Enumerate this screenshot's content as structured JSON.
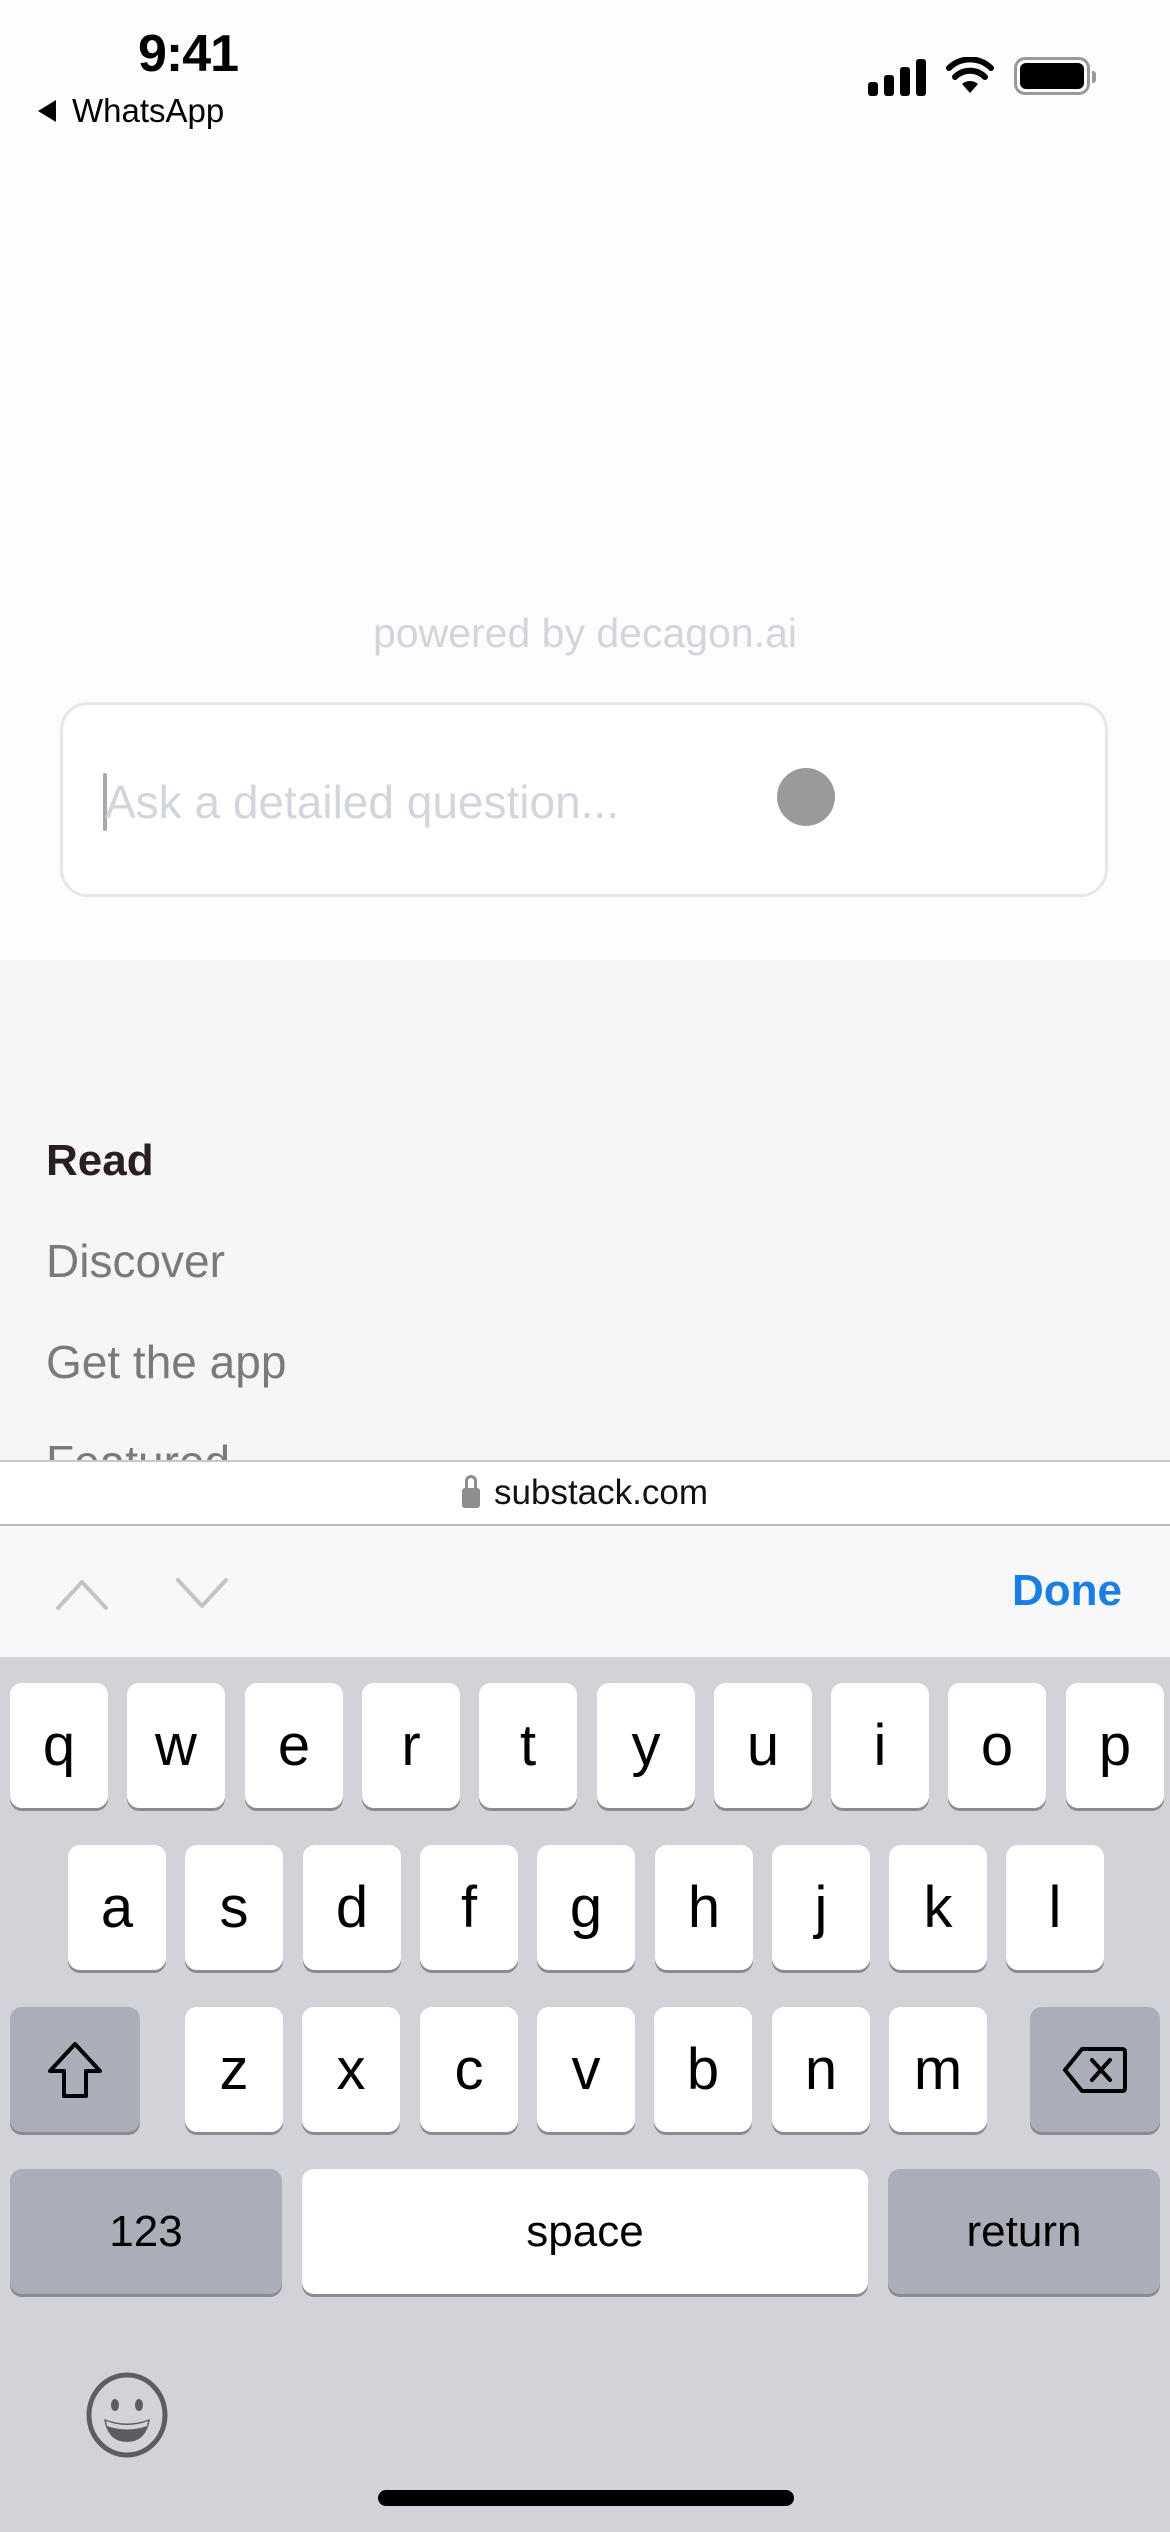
{
  "status_bar": {
    "time": "9:41",
    "back_app": "WhatsApp",
    "icons": [
      "cellular-signal-icon",
      "wifi-icon",
      "battery-icon"
    ]
  },
  "chat_widget": {
    "powered_by": "powered by decagon.ai",
    "input_placeholder": "Ask a detailed question...",
    "input_value": "",
    "loading_indicator": "loading-dot"
  },
  "page_nav": {
    "items": [
      {
        "label": "Read",
        "active": true
      },
      {
        "label": "Discover",
        "active": false
      },
      {
        "label": "Get the app",
        "active": false
      },
      {
        "label": "Featured",
        "active": false
      }
    ]
  },
  "browser": {
    "url": "substack.com",
    "secure": true
  },
  "accessory_bar": {
    "prev_icon": "chevron-up-icon",
    "next_icon": "chevron-down-icon",
    "done_label": "Done",
    "accent_color": "#1a7fe0"
  },
  "keyboard": {
    "row1": [
      "q",
      "w",
      "e",
      "r",
      "t",
      "y",
      "u",
      "i",
      "o",
      "p"
    ],
    "row2": [
      "a",
      "s",
      "d",
      "f",
      "g",
      "h",
      "j",
      "k",
      "l"
    ],
    "row3": [
      "z",
      "x",
      "c",
      "v",
      "b",
      "n",
      "m"
    ],
    "numbers_label": "123",
    "space_label": "space",
    "return_label": "return",
    "shift_icon": "shift-icon",
    "delete_icon": "delete-icon",
    "emoji_icon": "emoji-icon"
  }
}
